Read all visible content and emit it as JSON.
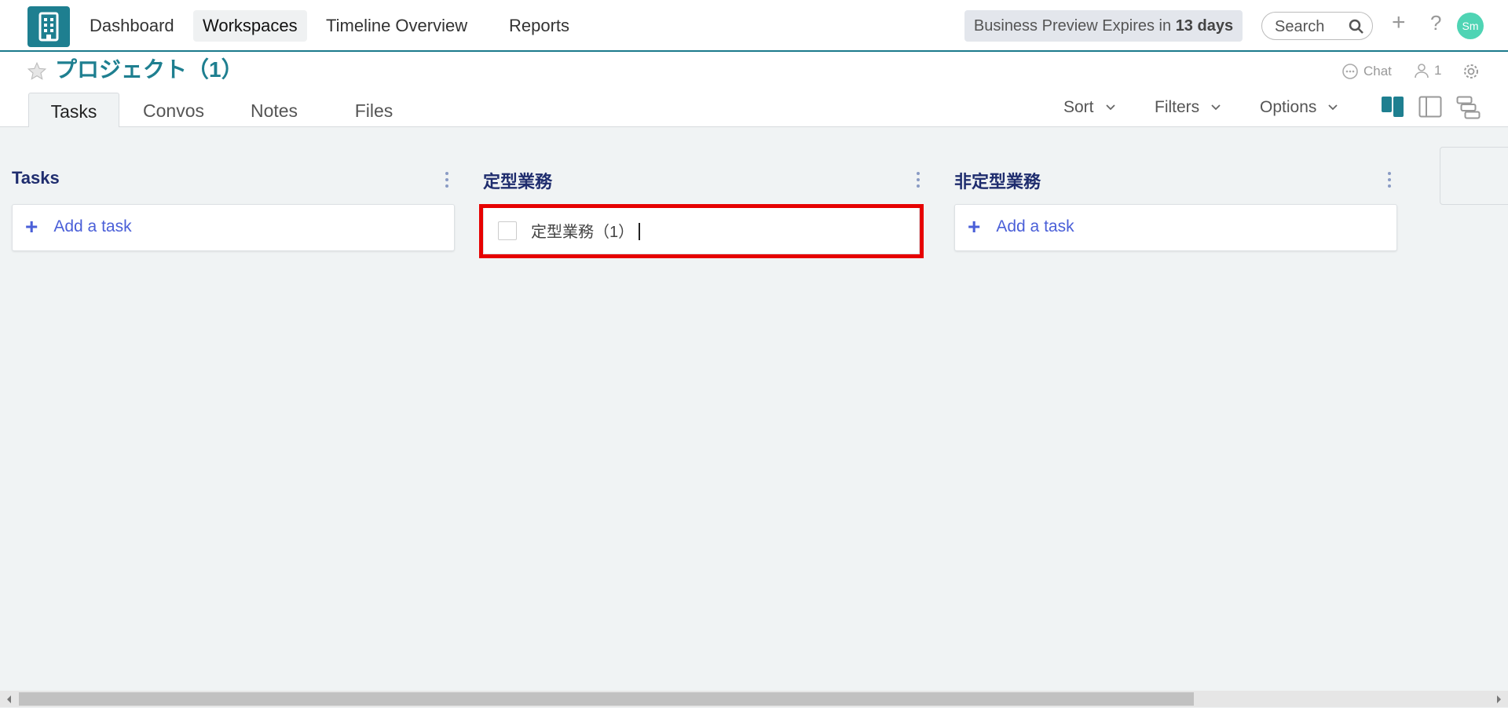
{
  "topnav": {
    "logo_icon": "building-icon",
    "items": [
      {
        "label": "Dashboard"
      },
      {
        "label": "Workspaces",
        "active": true
      },
      {
        "label": "Timeline Overview"
      },
      {
        "label": "Reports"
      }
    ],
    "preview_text": "Business Preview Expires in ",
    "preview_days": "13 days",
    "search_placeholder": "Search",
    "plus_icon": "+",
    "help_icon": "?",
    "avatar_initials": "Sm"
  },
  "project": {
    "title": "プロジェクト（1）",
    "chat_label": "Chat",
    "members_count": "1",
    "tabs": [
      {
        "label": "Tasks",
        "active": true
      },
      {
        "label": "Convos"
      },
      {
        "label": "Notes"
      },
      {
        "label": "Files"
      }
    ],
    "controls": {
      "sort": "Sort",
      "filters": "Filters",
      "options": "Options"
    }
  },
  "board": {
    "columns": [
      {
        "title": "Tasks",
        "add_label": "Add a task"
      },
      {
        "title": "定型業務",
        "task_title": "定型業務（1）"
      },
      {
        "title": "非定型業務",
        "add_label": "Add a task"
      }
    ]
  },
  "colors": {
    "brand": "#1e7f90",
    "column_title": "#1f2d6e",
    "add_task": "#4a5fd8",
    "highlight": "#e60000",
    "avatar": "#4fd4b4"
  }
}
